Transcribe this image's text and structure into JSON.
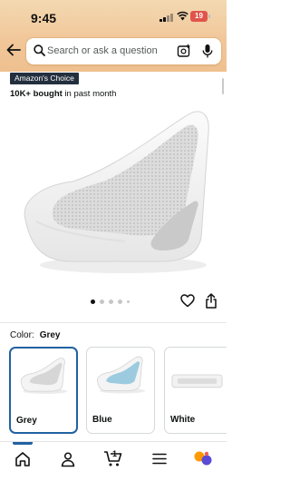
{
  "status_bar": {
    "time": "9:45",
    "battery": "19"
  },
  "search": {
    "placeholder": "Search or ask a question"
  },
  "product": {
    "badge": "Amazon's Choice",
    "bought_count": "10K+ bought",
    "bought_suffix": " in past month",
    "image_dots": {
      "count": 5,
      "active_index": 0
    }
  },
  "color": {
    "label": "Color:",
    "selected": "Grey",
    "options": [
      {
        "label": "Grey",
        "tint": "#e2e4e6"
      },
      {
        "label": "Blue",
        "tint": "#9ccbe0"
      },
      {
        "label": "White",
        "tint": "#f2f2f2"
      }
    ]
  },
  "bottom_nav": {
    "items": [
      "home-icon",
      "account-icon",
      "cart-icon",
      "menu-icon",
      "rufus-icon"
    ],
    "active_index": 0,
    "cart_count": "1"
  },
  "colors": {
    "header_top": "#f3d9b1",
    "header_bottom": "#efc08f",
    "selection_blue": "#2162a1",
    "badge_bg": "#232f3e"
  }
}
